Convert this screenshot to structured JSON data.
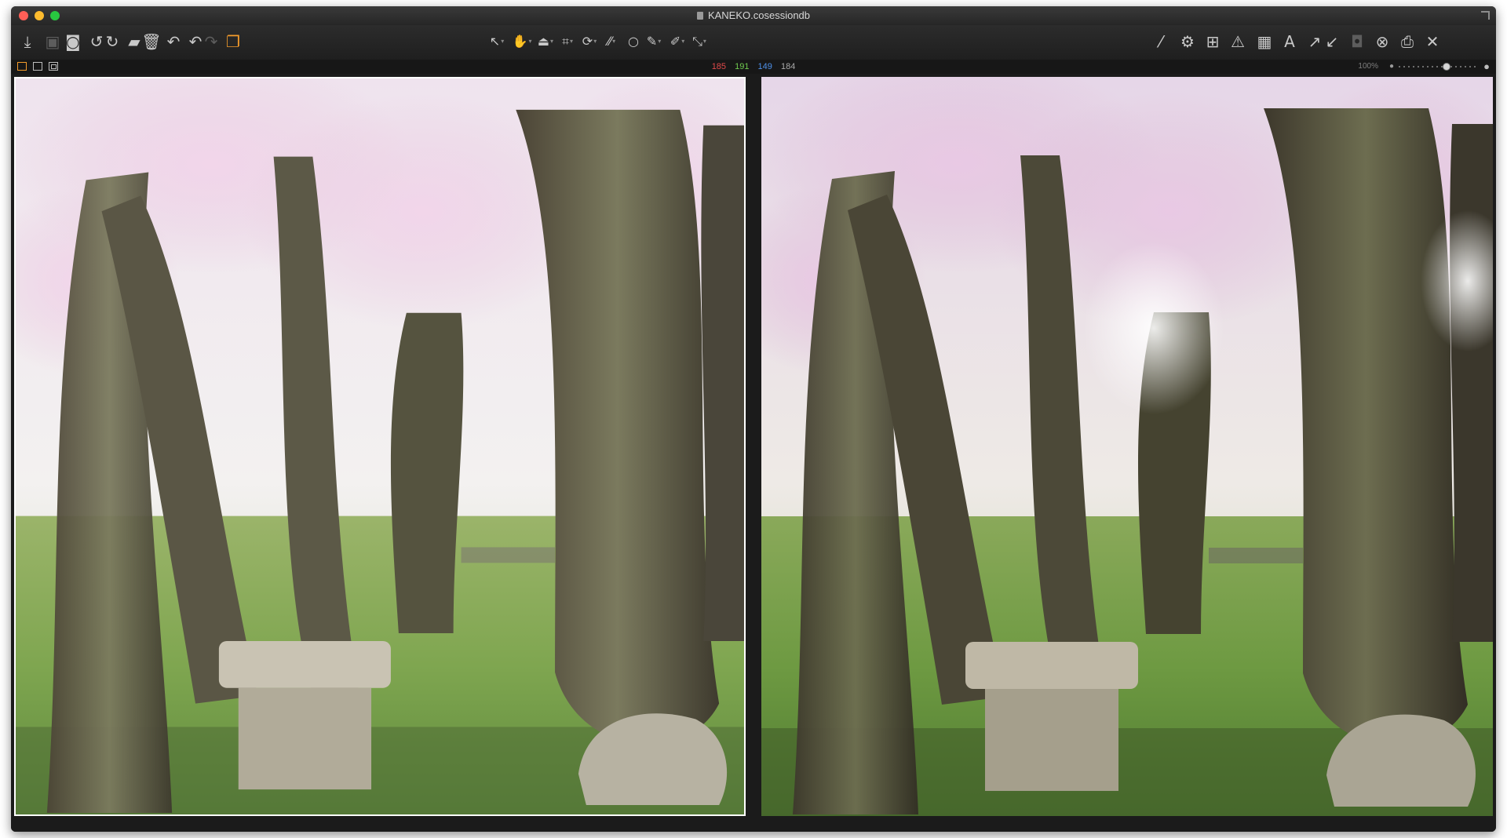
{
  "window": {
    "title": "KANEKO.cosessiondb"
  },
  "toolbar": {
    "left_icons": [
      "import-icon",
      "camera-icon",
      "capture-icon",
      "rotate-left-icon",
      "rotate-right-icon",
      "folder-icon",
      "trash-icon",
      "undo-history-icon",
      "undo-icon",
      "redo-icon",
      "variants-icon"
    ],
    "center_tools": [
      "select-cursor-icon",
      "pan-hand-icon",
      "loupe-icon",
      "crop-icon",
      "rotate-tool-icon",
      "keystone-icon",
      "circle-mask-icon",
      "brush-icon",
      "eraser-icon",
      "picker-icon"
    ],
    "right_icons": [
      "adjustments-brush-icon",
      "settings-icon",
      "layout-icon",
      "warning-icon",
      "grid-icon",
      "text-icon",
      "apply-icon",
      "copy-icon",
      "camera-tethered-icon",
      "cancel-icon",
      "print-icon",
      "tools-icon"
    ]
  },
  "readout": {
    "r": "185",
    "g": "191",
    "b": "149",
    "l": "184"
  },
  "zoom": {
    "label": "100%",
    "level": 0.62
  },
  "colors": {
    "accent": "#f39b2b",
    "r": "#e0494a",
    "g": "#6fca4f",
    "b": "#4d8fe8",
    "l": "#a8a8a8"
  }
}
